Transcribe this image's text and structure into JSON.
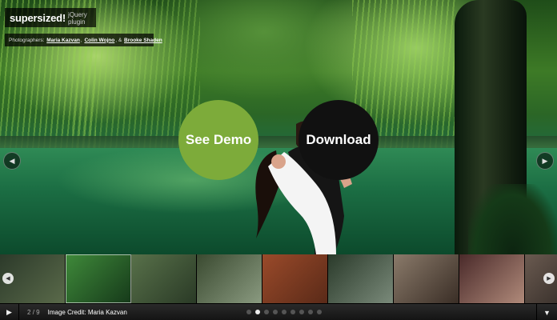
{
  "logo": {
    "main": "supersized!",
    "sub": "jQuery plugin"
  },
  "credits": {
    "prefix": "Photographers:",
    "photographer_1": "Maria Kazvan",
    "sep_1": ",",
    "photographer_2": "Colin Wojno",
    "sep_2": ", &",
    "photographer_3": "Brooke Shaden"
  },
  "cta": {
    "demo_label": "See Demo",
    "download_label": "Download"
  },
  "controls": {
    "prev_icon": "chevron-left-icon",
    "next_icon": "chevron-right-icon",
    "play_icon": "play-icon",
    "tray_toggle_icon": "triangle-down-icon"
  },
  "status": {
    "current": "2",
    "divider": "/",
    "total": "9",
    "caption": "Image Credit: Maria Kazvan"
  },
  "slides": {
    "count": 9,
    "active_index": 1
  },
  "thumbnails": [
    {
      "name": "thumb-1",
      "colors": [
        "#2c3a2a",
        "#5a6a4a"
      ]
    },
    {
      "name": "thumb-2",
      "colors": [
        "#3f8a3a",
        "#163a1a"
      ]
    },
    {
      "name": "thumb-3",
      "colors": [
        "#58714a",
        "#2a3a26"
      ]
    },
    {
      "name": "thumb-4",
      "colors": [
        "#3a4a30",
        "#8a9a80"
      ]
    },
    {
      "name": "thumb-5",
      "colors": [
        "#9a4a2a",
        "#5a2a18"
      ]
    },
    {
      "name": "thumb-6",
      "colors": [
        "#2a3a2a",
        "#7a8a7a"
      ]
    },
    {
      "name": "thumb-7",
      "colors": [
        "#8a7a6a",
        "#3a2e26"
      ]
    },
    {
      "name": "thumb-8",
      "colors": [
        "#4a2a2a",
        "#b08a7a"
      ]
    },
    {
      "name": "thumb-9",
      "colors": [
        "#6a5a50",
        "#2a2420"
      ]
    }
  ],
  "colors": {
    "demo_button": "#7dab3a",
    "download_button": "#111111",
    "active_dot": "#eeeeee",
    "dot": "#555555"
  }
}
